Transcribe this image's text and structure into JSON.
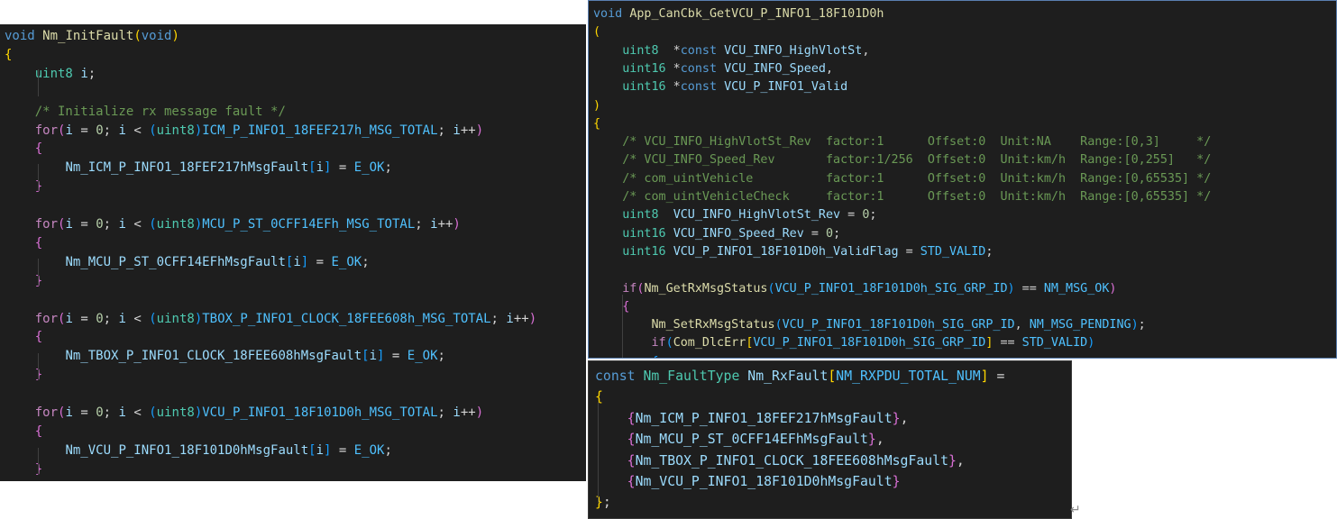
{
  "colors": {
    "editor_bg": "#1e1e1e",
    "keyword": "#569cd6",
    "control": "#c586c0",
    "function": "#dcdcaa",
    "type": "#4ec9b0",
    "macro": "#4fc1ff",
    "variable": "#9cdcfe",
    "number": "#b5cea8",
    "comment": "#6a9955",
    "bracket_1": "#ffd700",
    "bracket_2": "#da70d6",
    "bracket_3": "#179fff",
    "plain": "#d4d4d4"
  },
  "editors": [
    {
      "name": "nm-initfault",
      "lines": [
        [
          [
            "kw",
            "void "
          ],
          [
            "fn",
            "Nm_InitFault"
          ],
          [
            "br1",
            "("
          ],
          [
            "kw",
            "void"
          ],
          [
            "br1",
            ")"
          ]
        ],
        [
          [
            "br1",
            "{"
          ]
        ],
        [
          [
            "pl",
            "    "
          ],
          [
            "ty",
            "uint8"
          ],
          [
            "pl",
            " "
          ],
          [
            "var",
            "i"
          ],
          [
            "pl",
            ";"
          ]
        ],
        [],
        [
          [
            "pl",
            "    "
          ],
          [
            "cm",
            "/* Initialize rx message fault */"
          ]
        ],
        [
          [
            "pl",
            "    "
          ],
          [
            "ctl",
            "for"
          ],
          [
            "br2",
            "("
          ],
          [
            "var",
            "i"
          ],
          [
            "pl",
            " = "
          ],
          [
            "num",
            "0"
          ],
          [
            "pl",
            "; "
          ],
          [
            "var",
            "i"
          ],
          [
            "pl",
            " < "
          ],
          [
            "br3",
            "("
          ],
          [
            "ty",
            "uint8"
          ],
          [
            "br3",
            ")"
          ],
          [
            "mac",
            "ICM_P_INFO1_18FEF217h_MSG_TOTAL"
          ],
          [
            "pl",
            "; "
          ],
          [
            "var",
            "i"
          ],
          [
            "pl",
            "++"
          ],
          [
            "br2",
            ")"
          ]
        ],
        [
          [
            "pl",
            "    "
          ],
          [
            "br2",
            "{"
          ]
        ],
        [
          [
            "pl",
            "        "
          ],
          [
            "var",
            "Nm_ICM_P_INFO1_18FEF217hMsgFault"
          ],
          [
            "br3",
            "["
          ],
          [
            "var",
            "i"
          ],
          [
            "br3",
            "]"
          ],
          [
            "pl",
            " = "
          ],
          [
            "mac",
            "E_OK"
          ],
          [
            "pl",
            ";"
          ]
        ],
        [
          [
            "pl",
            "    "
          ],
          [
            "br2",
            "}"
          ]
        ],
        [],
        [
          [
            "pl",
            "    "
          ],
          [
            "ctl",
            "for"
          ],
          [
            "br2",
            "("
          ],
          [
            "var",
            "i"
          ],
          [
            "pl",
            " = "
          ],
          [
            "num",
            "0"
          ],
          [
            "pl",
            "; "
          ],
          [
            "var",
            "i"
          ],
          [
            "pl",
            " < "
          ],
          [
            "br3",
            "("
          ],
          [
            "ty",
            "uint8"
          ],
          [
            "br3",
            ")"
          ],
          [
            "mac",
            "MCU_P_ST_0CFF14EFh_MSG_TOTAL"
          ],
          [
            "pl",
            "; "
          ],
          [
            "var",
            "i"
          ],
          [
            "pl",
            "++"
          ],
          [
            "br2",
            ")"
          ]
        ],
        [
          [
            "pl",
            "    "
          ],
          [
            "br2",
            "{"
          ]
        ],
        [
          [
            "pl",
            "        "
          ],
          [
            "var",
            "Nm_MCU_P_ST_0CFF14EFhMsgFault"
          ],
          [
            "br3",
            "["
          ],
          [
            "var",
            "i"
          ],
          [
            "br3",
            "]"
          ],
          [
            "pl",
            " = "
          ],
          [
            "mac",
            "E_OK"
          ],
          [
            "pl",
            ";"
          ]
        ],
        [
          [
            "pl",
            "    "
          ],
          [
            "br2",
            "}"
          ]
        ],
        [],
        [
          [
            "pl",
            "    "
          ],
          [
            "ctl",
            "for"
          ],
          [
            "br2",
            "("
          ],
          [
            "var",
            "i"
          ],
          [
            "pl",
            " = "
          ],
          [
            "num",
            "0"
          ],
          [
            "pl",
            "; "
          ],
          [
            "var",
            "i"
          ],
          [
            "pl",
            " < "
          ],
          [
            "br3",
            "("
          ],
          [
            "ty",
            "uint8"
          ],
          [
            "br3",
            ")"
          ],
          [
            "mac",
            "TBOX_P_INFO1_CLOCK_18FEE608h_MSG_TOTAL"
          ],
          [
            "pl",
            "; "
          ],
          [
            "var",
            "i"
          ],
          [
            "pl",
            "++"
          ],
          [
            "br2",
            ")"
          ]
        ],
        [
          [
            "pl",
            "    "
          ],
          [
            "br2",
            "{"
          ]
        ],
        [
          [
            "pl",
            "        "
          ],
          [
            "var",
            "Nm_TBOX_P_INFO1_CLOCK_18FEE608hMsgFault"
          ],
          [
            "br3",
            "["
          ],
          [
            "var",
            "i"
          ],
          [
            "br3",
            "]"
          ],
          [
            "pl",
            " = "
          ],
          [
            "mac",
            "E_OK"
          ],
          [
            "pl",
            ";"
          ]
        ],
        [
          [
            "pl",
            "    "
          ],
          [
            "br2",
            "}"
          ]
        ],
        [],
        [
          [
            "pl",
            "    "
          ],
          [
            "ctl",
            "for"
          ],
          [
            "br2",
            "("
          ],
          [
            "var",
            "i"
          ],
          [
            "pl",
            " = "
          ],
          [
            "num",
            "0"
          ],
          [
            "pl",
            "; "
          ],
          [
            "var",
            "i"
          ],
          [
            "pl",
            " < "
          ],
          [
            "br3",
            "("
          ],
          [
            "ty",
            "uint8"
          ],
          [
            "br3",
            ")"
          ],
          [
            "mac",
            "VCU_P_INFO1_18F101D0h_MSG_TOTAL"
          ],
          [
            "pl",
            "; "
          ],
          [
            "var",
            "i"
          ],
          [
            "pl",
            "++"
          ],
          [
            "br2",
            ")"
          ]
        ],
        [
          [
            "pl",
            "    "
          ],
          [
            "br2",
            "{"
          ]
        ],
        [
          [
            "pl",
            "        "
          ],
          [
            "var",
            "Nm_VCU_P_INFO1_18F101D0hMsgFault"
          ],
          [
            "br3",
            "["
          ],
          [
            "var",
            "i"
          ],
          [
            "br3",
            "]"
          ],
          [
            "pl",
            " = "
          ],
          [
            "mac",
            "E_OK"
          ],
          [
            "pl",
            ";"
          ]
        ],
        [
          [
            "pl",
            "    "
          ],
          [
            "br2",
            "}"
          ]
        ]
      ]
    },
    {
      "name": "app-cancbk-getvcu",
      "lines": [
        [
          [
            "kw",
            "void "
          ],
          [
            "fn",
            "App_CanCbk_GetVCU_P_INFO1_18F101D0h"
          ]
        ],
        [
          [
            "br1",
            "("
          ]
        ],
        [
          [
            "pl",
            "    "
          ],
          [
            "ty",
            "uint8"
          ],
          [
            "pl",
            "  *"
          ],
          [
            "kw",
            "const"
          ],
          [
            "pl",
            " "
          ],
          [
            "var",
            "VCU_INFO_HighVlotSt"
          ],
          [
            "pl",
            ","
          ]
        ],
        [
          [
            "pl",
            "    "
          ],
          [
            "ty",
            "uint16"
          ],
          [
            "pl",
            " *"
          ],
          [
            "kw",
            "const"
          ],
          [
            "pl",
            " "
          ],
          [
            "var",
            "VCU_INFO_Speed"
          ],
          [
            "pl",
            ","
          ]
        ],
        [
          [
            "pl",
            "    "
          ],
          [
            "ty",
            "uint16"
          ],
          [
            "pl",
            " *"
          ],
          [
            "kw",
            "const"
          ],
          [
            "pl",
            " "
          ],
          [
            "var",
            "VCU_P_INFO1_Valid"
          ]
        ],
        [
          [
            "br1",
            ")"
          ]
        ],
        [
          [
            "br1",
            "{"
          ]
        ],
        [
          [
            "pl",
            "    "
          ],
          [
            "cm",
            "/* VCU_INFO_HighVlotSt_Rev  factor:1      Offset:0  Unit:NA    Range:[0,3]     */"
          ]
        ],
        [
          [
            "pl",
            "    "
          ],
          [
            "cm",
            "/* VCU_INFO_Speed_Rev       factor:1/256  Offset:0  Unit:km/h  Range:[0,255]   */"
          ]
        ],
        [
          [
            "pl",
            "    "
          ],
          [
            "cm",
            "/* com_uintVehicle          factor:1      Offset:0  Unit:km/h  Range:[0,65535] */"
          ]
        ],
        [
          [
            "pl",
            "    "
          ],
          [
            "cm",
            "/* com_uintVehicleCheck     factor:1      Offset:0  Unit:km/h  Range:[0,65535] */"
          ]
        ],
        [
          [
            "pl",
            "    "
          ],
          [
            "ty",
            "uint8"
          ],
          [
            "pl",
            "  "
          ],
          [
            "var",
            "VCU_INFO_HighVlotSt_Rev"
          ],
          [
            "pl",
            " = "
          ],
          [
            "num",
            "0"
          ],
          [
            "pl",
            ";"
          ]
        ],
        [
          [
            "pl",
            "    "
          ],
          [
            "ty",
            "uint16"
          ],
          [
            "pl",
            " "
          ],
          [
            "var",
            "VCU_INFO_Speed_Rev"
          ],
          [
            "pl",
            " = "
          ],
          [
            "num",
            "0"
          ],
          [
            "pl",
            ";"
          ]
        ],
        [
          [
            "pl",
            "    "
          ],
          [
            "ty",
            "uint16"
          ],
          [
            "pl",
            " "
          ],
          [
            "var",
            "VCU_P_INFO1_18F101D0h_ValidFlag"
          ],
          [
            "pl",
            " = "
          ],
          [
            "mac",
            "STD_VALID"
          ],
          [
            "pl",
            ";"
          ]
        ],
        [],
        [
          [
            "pl",
            "    "
          ],
          [
            "ctl",
            "if"
          ],
          [
            "br2",
            "("
          ],
          [
            "fn",
            "Nm_GetRxMsgStatus"
          ],
          [
            "br3",
            "("
          ],
          [
            "mac",
            "VCU_P_INFO1_18F101D0h_SIG_GRP_ID"
          ],
          [
            "br3",
            ")"
          ],
          [
            "pl",
            " == "
          ],
          [
            "mac",
            "NM_MSG_OK"
          ],
          [
            "br2",
            ")"
          ]
        ],
        [
          [
            "pl",
            "    "
          ],
          [
            "br2",
            "{"
          ]
        ],
        [
          [
            "pl",
            "        "
          ],
          [
            "fn",
            "Nm_SetRxMsgStatus"
          ],
          [
            "br3",
            "("
          ],
          [
            "mac",
            "VCU_P_INFO1_18F101D0h_SIG_GRP_ID"
          ],
          [
            "pl",
            ", "
          ],
          [
            "mac",
            "NM_MSG_PENDING"
          ],
          [
            "br3",
            ")"
          ],
          [
            "pl",
            ";"
          ]
        ],
        [
          [
            "pl",
            "        "
          ],
          [
            "ctl",
            "if"
          ],
          [
            "br3",
            "("
          ],
          [
            "fn",
            "Com_DlcErr"
          ],
          [
            "br1",
            "["
          ],
          [
            "mac",
            "VCU_P_INFO1_18F101D0h_SIG_GRP_ID"
          ],
          [
            "br1",
            "]"
          ],
          [
            "pl",
            " == "
          ],
          [
            "mac",
            "STD_VALID"
          ],
          [
            "br3",
            ")"
          ]
        ],
        [
          [
            "pl",
            "        "
          ],
          [
            "br3",
            "{"
          ]
        ]
      ]
    },
    {
      "name": "nm-rxfault-table",
      "lines": [
        [
          [
            "kw",
            "const "
          ],
          [
            "ty",
            "Nm_FaultType"
          ],
          [
            "pl",
            " "
          ],
          [
            "var",
            "Nm_RxFault"
          ],
          [
            "br1",
            "["
          ],
          [
            "mac",
            "NM_RXPDU_TOTAL_NUM"
          ],
          [
            "br1",
            "]"
          ],
          [
            "pl",
            " ="
          ]
        ],
        [
          [
            "br1",
            "{"
          ]
        ],
        [
          [
            "pl",
            "    "
          ],
          [
            "br2",
            "{"
          ],
          [
            "var",
            "Nm_ICM_P_INFO1_18FEF217hMsgFault"
          ],
          [
            "br2",
            "}"
          ],
          [
            "pl",
            ","
          ]
        ],
        [
          [
            "pl",
            "    "
          ],
          [
            "br2",
            "{"
          ],
          [
            "var",
            "Nm_MCU_P_ST_0CFF14EFhMsgFault"
          ],
          [
            "br2",
            "}"
          ],
          [
            "pl",
            ","
          ]
        ],
        [
          [
            "pl",
            "    "
          ],
          [
            "br2",
            "{"
          ],
          [
            "var",
            "Nm_TBOX_P_INFO1_CLOCK_18FEE608hMsgFault"
          ],
          [
            "br2",
            "}"
          ],
          [
            "pl",
            ","
          ]
        ],
        [
          [
            "pl",
            "    "
          ],
          [
            "br2",
            "{"
          ],
          [
            "var",
            "Nm_VCU_P_INFO1_18F101D0hMsgFault"
          ],
          [
            "br2",
            "}"
          ]
        ],
        [
          [
            "br1",
            "}"
          ],
          [
            "pl",
            ";"
          ]
        ]
      ]
    }
  ],
  "return_mark": "↵"
}
